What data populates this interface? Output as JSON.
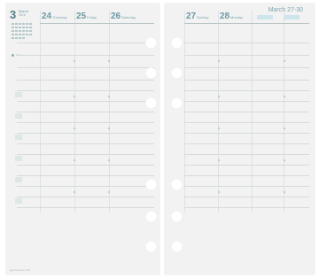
{
  "left_page": {
    "month_number": "3",
    "month_word": "March",
    "year": "2016",
    "days": [
      {
        "date": "24",
        "weekday": "Thursday"
      },
      {
        "date": "25",
        "weekday": "Friday"
      },
      {
        "date": "26",
        "weekday": "Saturday"
      }
    ],
    "note_label": "Notes",
    "footer": "agenda planner refill"
  },
  "right_page": {
    "header": "March 27-30",
    "days": [
      {
        "date": "27",
        "weekday": "Sunday"
      },
      {
        "date": "28",
        "weekday": "Monday"
      }
    ]
  },
  "colors": {
    "accent": "#6d9aa5",
    "paper": "#f1f2f1",
    "line": "#d7dbdb",
    "hole": "#ffffff"
  }
}
